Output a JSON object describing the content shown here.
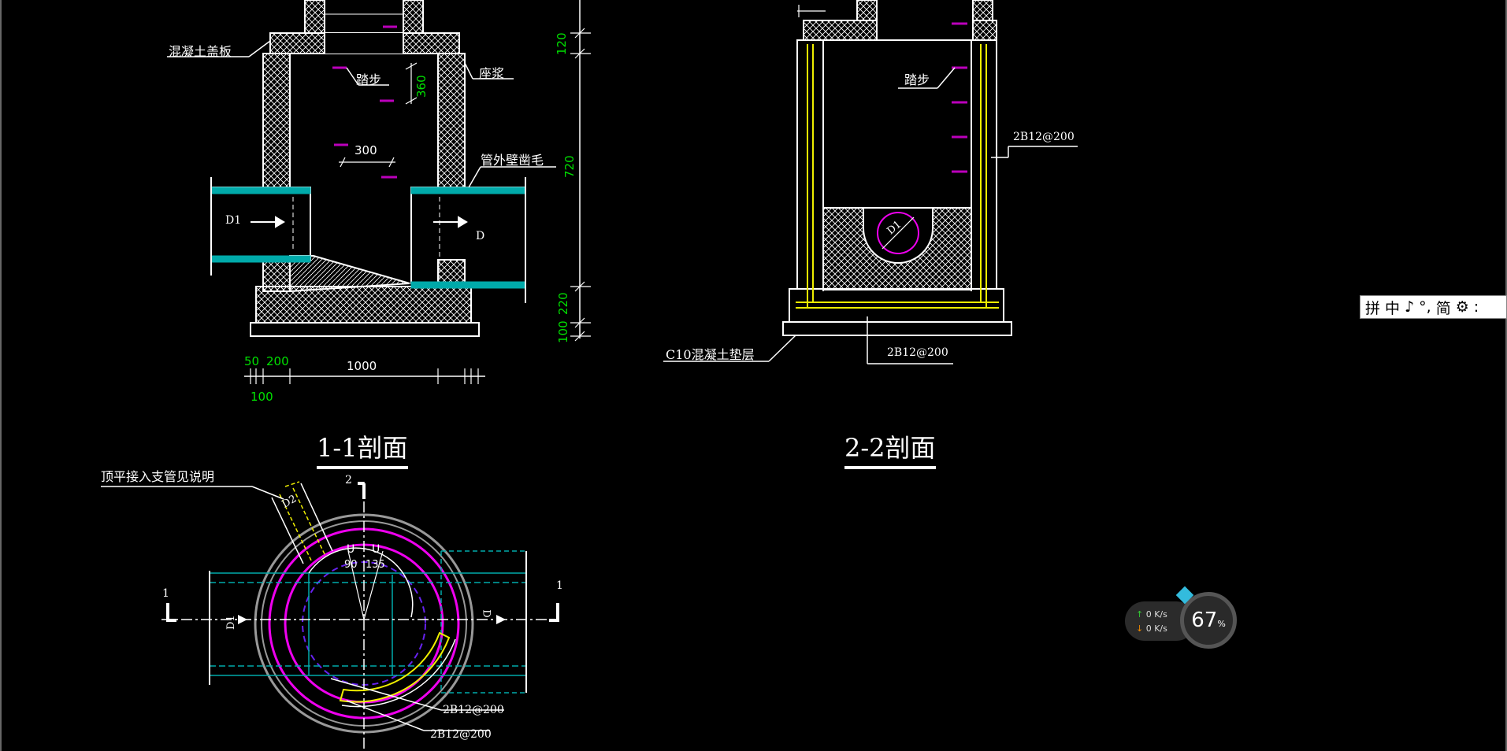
{
  "section_1": {
    "title": "1-1剖面",
    "labels": {
      "cover_slab": "混凝土盖板",
      "step": "踏步",
      "mortar": "座浆",
      "roughen": "管外壁凿毛",
      "inlet": "D1",
      "outlet": "D"
    },
    "dims": {
      "step_spacing": "360",
      "step_width": "300",
      "cover_thk": "120",
      "mid_height": "720",
      "base_thk": "220",
      "cushion_thk": "100",
      "d50": "50",
      "d200": "200",
      "d100": "100",
      "inner_width": "1000"
    }
  },
  "section_2": {
    "title": "2-2剖面",
    "labels": {
      "step": "踏步",
      "rebar_wall": "2B12@200",
      "cushion": "C10混凝土垫层",
      "rebar_base": "2B12@200",
      "channel": "D1"
    }
  },
  "plan": {
    "note": "顶平接入支管见说明",
    "branch": "D2",
    "inlet": "D1",
    "outlet": "D",
    "angle_a": "90",
    "angle_b": "135",
    "cut_1_left": "1",
    "cut_1_right": "1",
    "cut_2": "2",
    "rebar_1": "2B12@200",
    "rebar_2": "2B12@200"
  },
  "ime_toolbar": {
    "items": [
      "拼",
      "中",
      "♪",
      "°,",
      "简",
      "⚙",
      ":"
    ]
  },
  "network_widget": {
    "upload": "0",
    "download": "0",
    "unit": "K/s",
    "percent": "67",
    "percent_sign": "%"
  }
}
